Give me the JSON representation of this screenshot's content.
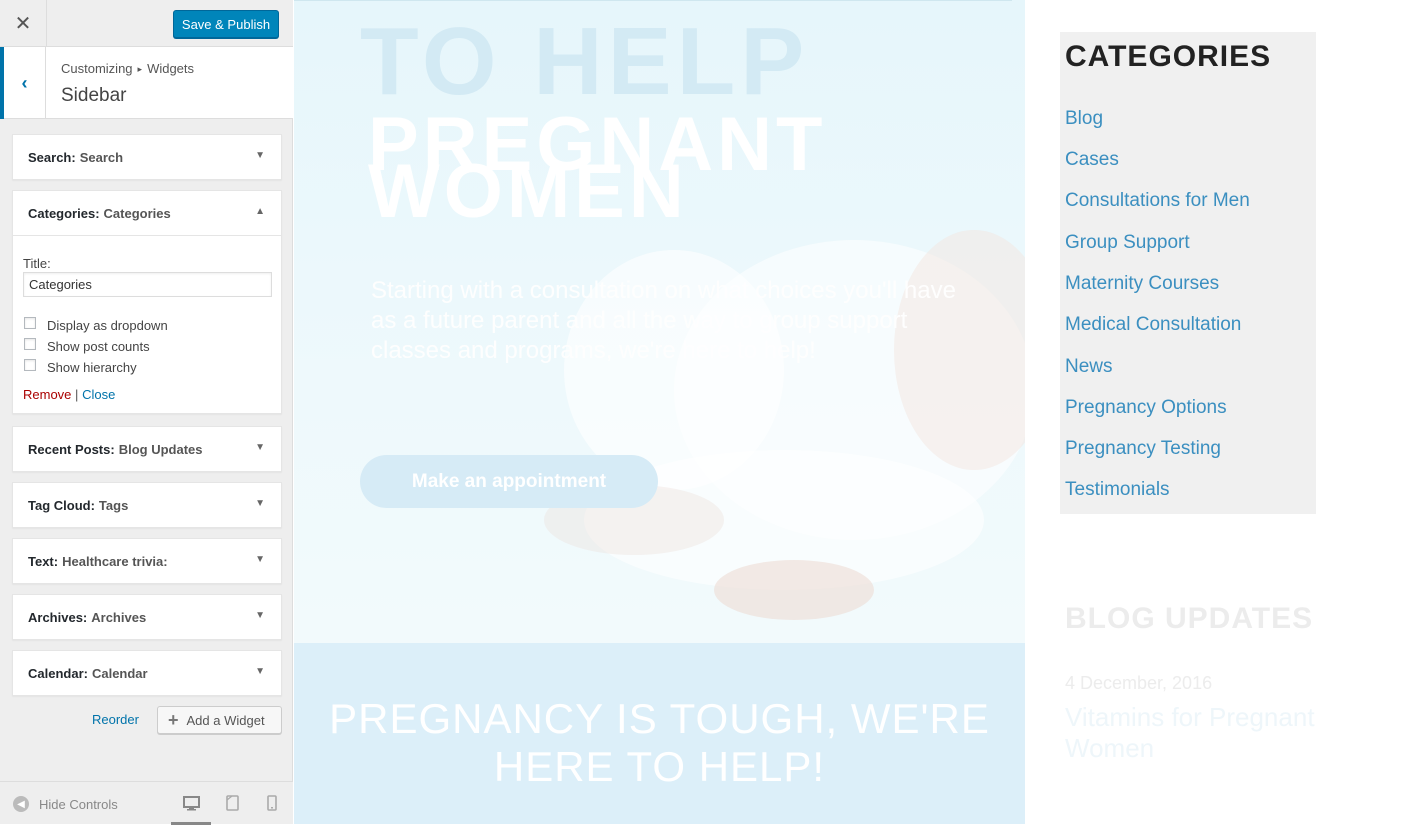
{
  "customizer": {
    "save_label": "Save & Publish",
    "breadcrumb": [
      "Customizing",
      "Widgets"
    ],
    "section_title": "Sidebar",
    "widgets": [
      {
        "type": "Search:",
        "title": "Search"
      },
      {
        "type": "Categories:",
        "title": "Categories"
      },
      {
        "type": "Recent Posts:",
        "title": "Blog Updates"
      },
      {
        "type": "Tag Cloud:",
        "title": "Tags"
      },
      {
        "type": "Text:",
        "title": "Healthcare trivia:"
      },
      {
        "type": "Archives:",
        "title": "Archives"
      },
      {
        "type": "Calendar:",
        "title": "Calendar"
      }
    ],
    "form": {
      "title_label": "Title:",
      "title_value": "Categories",
      "options": [
        "Display as dropdown",
        "Show post counts",
        "Show hierarchy"
      ],
      "remove_label": "Remove",
      "separator": "|",
      "close_label": "Close"
    },
    "reorder_label": "Reorder",
    "add_widget_label": "Add a Widget",
    "hide_controls_label": "Hide Controls"
  },
  "preview": {
    "hero_heading_1": "TO HELP",
    "hero_heading_2": "PREGNANT WOMEN",
    "hero_text": "Starting with a consultation on what choices you'll have as a future parent and all the way to group support classes and programs, we're here to help!",
    "hero_button": "Make an appointment",
    "band_text": "PREGNANCY IS TOUGH, WE'RE HERE TO HELP!",
    "categories_title": "CATEGORIES",
    "categories": [
      "Blog",
      "Cases",
      "Consultations for Men",
      "Group Support",
      "Maternity Courses",
      "Medical Consultation",
      "News",
      "Pregnancy Options",
      "Pregnancy Testing",
      "Testimonials"
    ],
    "blog_title": "BLOG UPDATES",
    "blog_date": "4 December, 2016",
    "blog_post": "Vitamins for Pregnant Women"
  },
  "colors": {
    "accent": "#0085ba",
    "link": "#0073aa",
    "remove": "#aa0000",
    "category_link": "#3b8fc0"
  },
  "icons": {
    "close": "close-icon",
    "back": "chevron-left-icon",
    "expand": "triangle-down-icon",
    "collapse": "triangle-up-icon",
    "add": "plus-icon",
    "hide_controls": "collapse-arrow-icon",
    "desktop": "desktop-icon",
    "tablet": "tablet-icon",
    "mobile": "mobile-icon"
  }
}
